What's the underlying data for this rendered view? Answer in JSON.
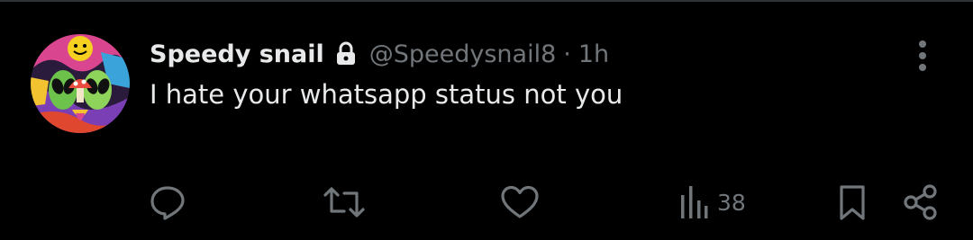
{
  "tweet": {
    "display_name": "Speedy snail",
    "handle": "@Speedysnail8",
    "separator": "·",
    "timestamp": "1h",
    "text": "I hate your whatsapp status not you",
    "protected": true,
    "avatar_description_icon": "alien-avatar"
  },
  "actions": {
    "reply_icon": "reply-icon",
    "retweet_icon": "retweet-icon",
    "like_icon": "heart-icon",
    "views_icon": "views-bar-chart-icon",
    "view_count": "38",
    "bookmark_icon": "bookmark-icon",
    "share_icon": "share-icon"
  },
  "colors": {
    "background": "#000000",
    "primary_text": "#e7e9ea",
    "secondary_text": "#71767b",
    "divider": "#2f3336"
  }
}
